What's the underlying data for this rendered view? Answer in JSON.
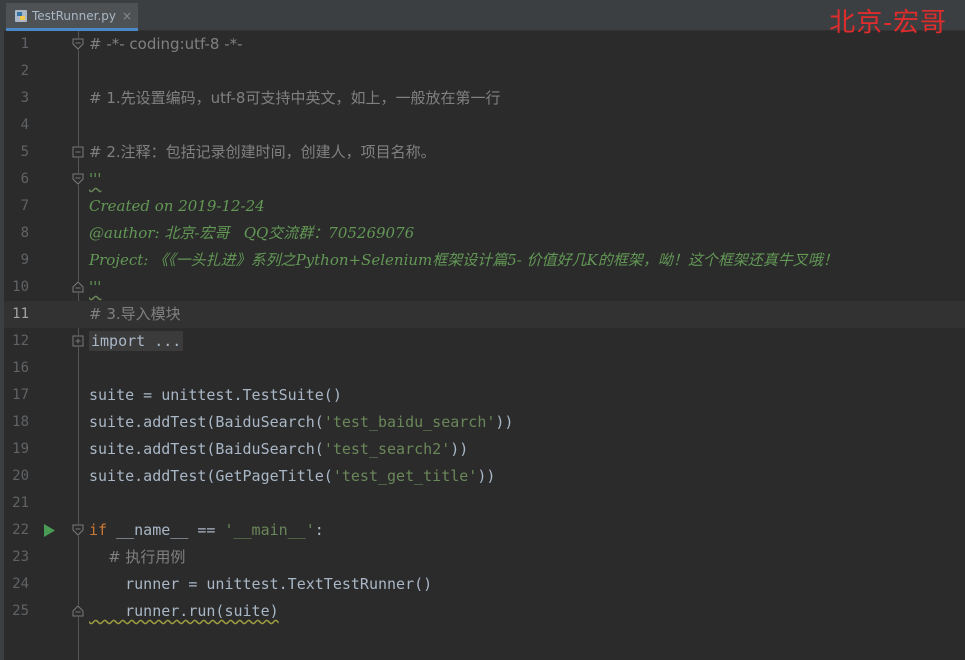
{
  "tab": {
    "filename": "TestRunner.py",
    "close_glyph": "×",
    "icon": "python-file-icon"
  },
  "watermark": "北京-宏哥",
  "colors": {
    "background": "#2b2b2b",
    "comment": "#808080",
    "docstring": "#629755",
    "keyword": "#cc7832",
    "string": "#6a8759",
    "identifier": "#a9b7c6",
    "line_number": "#606366",
    "current_line": "#323232",
    "run_icon": "#499c54",
    "watermark": "#e02c2c",
    "tab_underline": "#4a88c7"
  },
  "current_line_number": "11",
  "code": {
    "l1": {
      "num": "1",
      "text": "# -*- coding:utf-8 -*-"
    },
    "l2": {
      "num": "2"
    },
    "l3": {
      "num": "3",
      "text": "# 1.先设置编码，utf-8可支持中英文，如上，一般放在第一行"
    },
    "l4": {
      "num": "4"
    },
    "l5": {
      "num": "5",
      "text": "# 2.注释：包括记录创建时间，创建人，项目名称。"
    },
    "l6": {
      "num": "6",
      "text": "'''"
    },
    "l7": {
      "num": "7",
      "text": "Created on 2019-12-24"
    },
    "l8": {
      "num": "8",
      "text": "@author: 北京-宏哥   QQ交流群：705269076"
    },
    "l9": {
      "num": "9",
      "text": "Project: 《《一头扎进》系列之Python+Selenium框架设计篇5- 价值好几K的框架，呦！这个框架还真牛叉哦！"
    },
    "l10": {
      "num": "10",
      "text": "'''"
    },
    "l11": {
      "num": "11",
      "text": "# 3.导入模块"
    },
    "l12": {
      "num": "12",
      "text": "import ..."
    },
    "l16": {
      "num": "16"
    },
    "l17": {
      "num": "17",
      "text": "suite = unittest.TestSuite()"
    },
    "l18": {
      "num": "18",
      "pre": "suite.addTest(BaiduSearch(",
      "str": "'test_baidu_search'",
      "post": "))"
    },
    "l19": {
      "num": "19",
      "pre": "suite.addTest(BaiduSearch(",
      "str": "'test_search2'",
      "post": "))"
    },
    "l20": {
      "num": "20",
      "pre": "suite.addTest(GetPageTitle(",
      "str": "'test_get_title'",
      "post": "))"
    },
    "l21": {
      "num": "21"
    },
    "l22": {
      "num": "22",
      "kw": "if",
      "mid": " __name__ == ",
      "str": "'__main__'",
      "post": ":"
    },
    "l23": {
      "num": "23",
      "text": "    # 执行用例"
    },
    "l24": {
      "num": "24",
      "text": "    runner = unittest.TextTestRunner()"
    },
    "l25": {
      "num": "25",
      "indent": "    ",
      "text": "runner.run(suite)"
    }
  }
}
